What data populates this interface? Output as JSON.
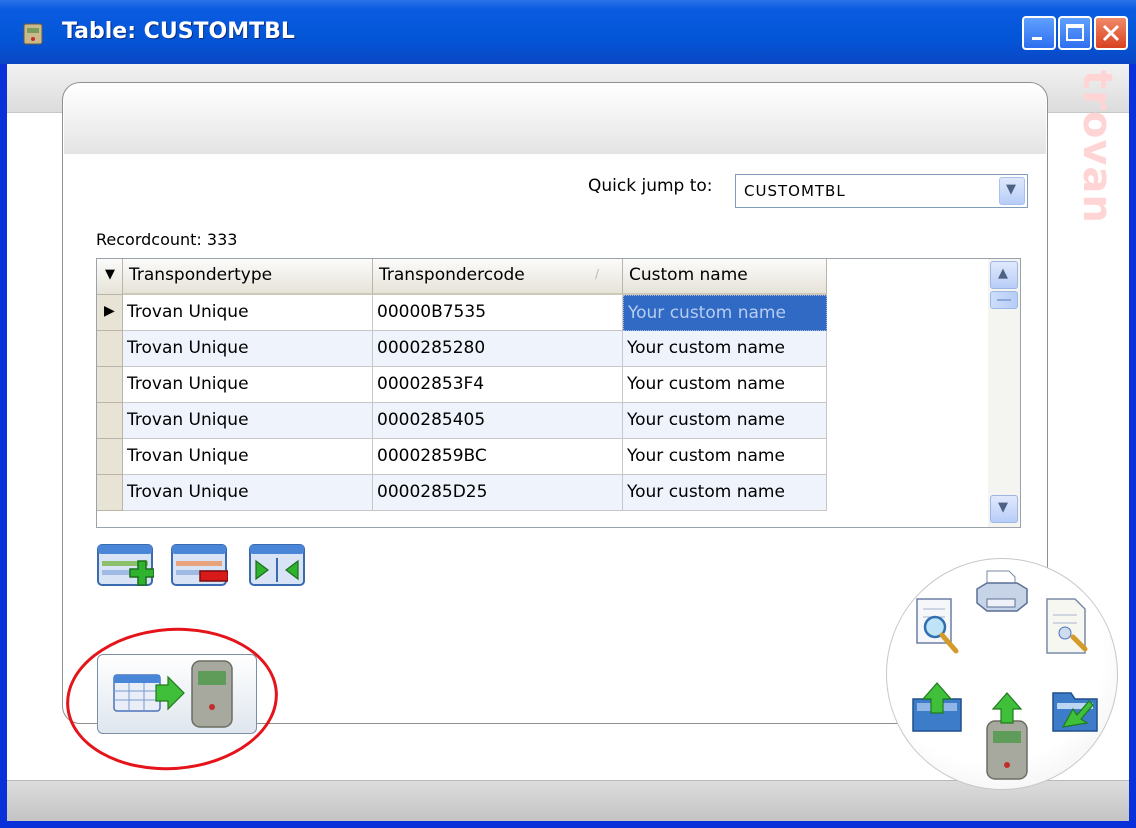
{
  "window": {
    "title": "Table: CUSTOMTBL",
    "brand_watermark": "trovan"
  },
  "quick_jump": {
    "label": "Quick jump to:",
    "selected": "CUSTOMTBL"
  },
  "recordcount_label": "Recordcount: 333",
  "table": {
    "columns": [
      "Transpondertype",
      "Transpondercode",
      "Custom name"
    ],
    "rows": [
      [
        "Trovan Unique",
        "00000B7535",
        "Your custom name"
      ],
      [
        "Trovan Unique",
        "0000285280",
        "Your custom name"
      ],
      [
        "Trovan Unique",
        "00002853F4",
        "Your custom name"
      ],
      [
        "Trovan Unique",
        "0000285405",
        "Your custom name"
      ],
      [
        "Trovan Unique",
        "00002859BC",
        "Your custom name"
      ],
      [
        "Trovan Unique",
        "0000285D25",
        "Your custom name"
      ]
    ]
  },
  "icons": {
    "add_record": "add-row-icon",
    "delete_record": "delete-row-icon",
    "compare": "merge-arrows-icon",
    "export_to_reader": "table-to-reader-icon",
    "print_preview": "print-preview-icon",
    "print": "printer-icon",
    "report": "report-icon",
    "import": "import-icon",
    "upload_reader": "reader-upload-icon",
    "export": "export-icon"
  },
  "colors": {
    "titlebar": "#0a5be0",
    "selection": "#316ac5",
    "annotation": "#e4141a"
  }
}
